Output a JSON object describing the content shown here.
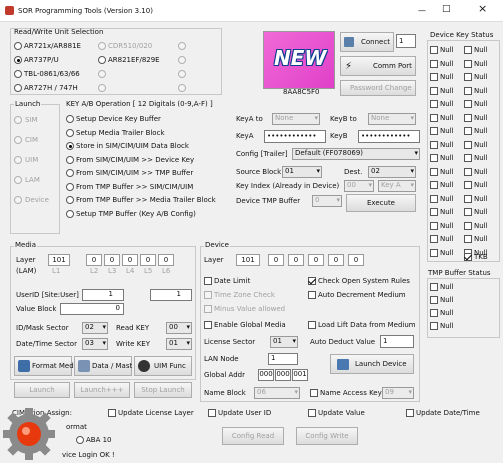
{
  "window": {
    "title": "SOR Programming Tools   (Version 3.10)",
    "min": "—",
    "max": "□",
    "close": "×"
  },
  "rw": {
    "title": "Read/Write Unit Selection",
    "items": [
      "AR721x/AR881E",
      "CDR510/020",
      "AR737P/U",
      "AR821EF/829E",
      "TBL-0861/63/66",
      "AR727H / 747H"
    ]
  },
  "newbtn": {
    "label": "NEW",
    "serial": "8AA8C5F0"
  },
  "conn": {
    "connect": "Connect",
    "port_value": "1",
    "comm": "Comm Port",
    "pwd": "Password Change"
  },
  "dks": {
    "title": "Device Key Status",
    "null": "Null"
  },
  "launch": {
    "title": "Launch",
    "items": [
      "SIM",
      "CIM",
      "UIM",
      "LAM",
      "Device"
    ]
  },
  "keyop": {
    "title": "KEY A/B Operation  [ 12 Digitals (0-9,A-F) ]",
    "items": [
      "Setup Device Key Buffer",
      "Setup Media Trailer Block",
      "Store in SIM/CIM/UIM Data Block",
      "From SIM/CIM/UIM  >> Device Key",
      "From SIM/CIM/UIM  >> TMP Buffer",
      "From TMP Buffer >> SIM/CIM/UIM",
      "From TMP Buffer >> Media Trailer Block",
      "Setup TMP Buffer (Key A/B  Config)"
    ]
  },
  "keys": {
    "keya_to": "KeyA  to",
    "keyb_to": "KeyB  to",
    "none": "None",
    "keya": "KeyA",
    "keyb": "KeyB",
    "masked": "••••••••••••",
    "cfg_label": "Config [Trailer]",
    "cfg_value": "Default (FF078069)",
    "src_label": "Source Block",
    "src_value": "01",
    "dest_label": "Dest.",
    "dest_value": "02",
    "idx_label": "Key Index (Already in Device)",
    "idx_value": "00",
    "idx_key": "Key A",
    "tmp_label": "Device TMP Buffer",
    "tmp_value": "0",
    "execute": "Execute"
  },
  "media": {
    "title": "Media",
    "layer": "Layer",
    "lam": "(LAM)",
    "vals": [
      "101",
      "0",
      "0",
      "0",
      "0",
      "0"
    ],
    "subs": [
      "L1",
      "L2",
      "L3",
      "L4",
      "L5",
      "L6"
    ],
    "userid": "UserID [Site:User]",
    "uid1": "1",
    "uid2": "1",
    "value_block": "Value Block",
    "vb": "0",
    "id_mask": "ID/Mask Sector",
    "id_val": "02",
    "read_key": "Read KEY",
    "rk": "00",
    "dt": "Date/Time Sector",
    "dt_val": "03",
    "write_key": "Write KEY",
    "wk": "01"
  },
  "device": {
    "title": "Device",
    "layer": "Layer",
    "vals": [
      "101",
      "0",
      "0",
      "0",
      "0",
      "0"
    ],
    "date_limit": "Date Limit",
    "check_power": "Check Open System Rules",
    "tz": "Time Zone Check",
    "auto_dec": "Auto Decrement Medium",
    "minus": "Minus Value allowed",
    "enable_global": "Enable Global Media",
    "load_lift": "Load Lift Data from Medium",
    "lic_sector": "License Sector",
    "lic_val": "01",
    "auto_deduct": "Auto Deduct Value",
    "deduct_val": "1",
    "lan": "LAN Node",
    "lan_val": "1",
    "launch_dev": "Launch Device",
    "global_addr": "Global Addr",
    "ga": [
      "000",
      "000",
      "001"
    ],
    "name_block": "Name Block",
    "nb": "06",
    "name_key": "Name Access Key",
    "nk": "09"
  },
  "tmp": {
    "title": "TMP Buffer Status",
    "null": "Null",
    "tkb": "TKB"
  },
  "fmt": {
    "format": "Format Medi",
    "data_mast": "Data / Mast",
    "uim": "UIM Func"
  },
  "launchrow": {
    "launch": "Launch",
    "launchpp": "Launch+++",
    "stop": "Stop Launch"
  },
  "assign": {
    "label": "CIM   ction Assign:",
    "upd_lic": "Update License Layer",
    "upd_uid": "Update User ID",
    "upd_val": "Update Value",
    "upd_dt": "Update Date/Time"
  },
  "bottom": {
    "format": "ormat",
    "aba": "ABA 10",
    "config_read": "Config Read",
    "config_write": "Config Write",
    "status": "vice Login OK !"
  }
}
